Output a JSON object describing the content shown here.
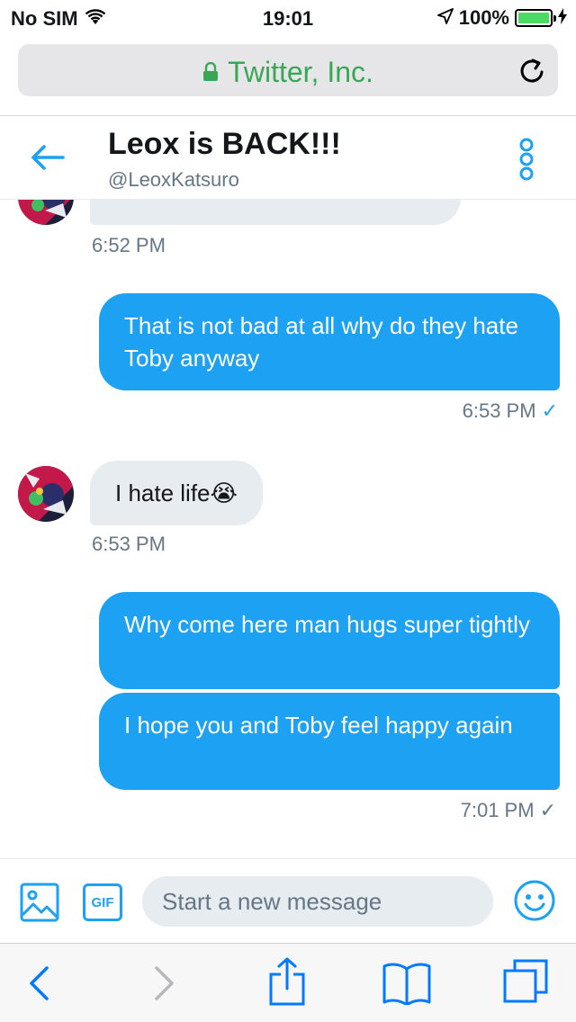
{
  "status_bar": {
    "carrier": "No SIM",
    "time": "19:01",
    "battery": "100%",
    "battery_level": 1.0
  },
  "browser": {
    "site_name": "Twitter, Inc.",
    "lock_icon": "lock-icon",
    "reload_icon": "reload-icon"
  },
  "header": {
    "name": "Leox is BACK!!!",
    "handle": "@LeoxKatsuro",
    "back_icon": "back-arrow-icon",
    "more_icon": "more-vertical-icon"
  },
  "messages": [
    {
      "direction": "in",
      "text": "",
      "time": "6:52 PM",
      "partial": true
    },
    {
      "direction": "out",
      "text": "That is not bad at all why do they hate Toby anyway",
      "time": "6:53 PM",
      "status": "✓"
    },
    {
      "direction": "in",
      "text": "I hate life😭",
      "time": "6:53 PM"
    },
    {
      "direction": "out",
      "text": "Why come here man hugs super tightly"
    },
    {
      "direction": "out",
      "text": "I hope you and Toby feel happy again",
      "time": "7:01 PM",
      "status": "✓"
    }
  ],
  "composer": {
    "placeholder": "Start a new message",
    "gif_label": "GIF",
    "image_icon": "image-icon",
    "emoji_icon": "emoji-icon"
  },
  "colors": {
    "accent": "#1da1f2",
    "incoming_bubble": "#e6ecf0",
    "secure_green": "#3aa757",
    "muted_text": "#657786",
    "safari_blue": "#007aff"
  }
}
